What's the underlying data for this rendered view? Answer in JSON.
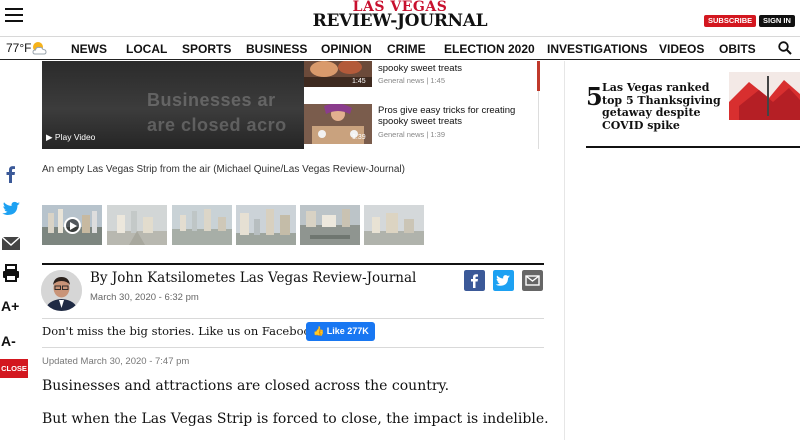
{
  "header": {
    "logo_line1": "LAS VEGAS",
    "logo_line2": "REVIEW-JOURNAL",
    "subscribe_label": "SUBSCRIBE",
    "signin_label": "SIGN IN",
    "menu_icon": "hamburger-menu-icon",
    "brand_color": "#c8102e"
  },
  "nav": {
    "weather": "77°F",
    "weather_icon": "partly-cloudy-icon",
    "items": [
      "NEWS",
      "LOCAL",
      "SPORTS",
      "BUSINESS",
      "OPINION",
      "CRIME",
      "ELECTION 2020",
      "INVESTIGATIONS",
      "VIDEOS",
      "OBITS"
    ],
    "search_icon": "search-icon"
  },
  "video": {
    "overlay_text_line1": "Businesses ar",
    "overlay_text_line2": "are closed acro",
    "play_label": "Play Video",
    "playlist": [
      {
        "title": "spooky sweet treats",
        "meta": "General news  |  1:45",
        "duration": "1:45"
      },
      {
        "title": "Pros give easy tricks for creating spooky sweet treats",
        "meta": "General news  |  1:39",
        "duration": "1:39"
      }
    ]
  },
  "caption": "An empty Las Vegas Strip from the air (Michael Quine/Las Vegas Review-Journal)",
  "gallery": {
    "thumb_count": 6
  },
  "share": {
    "icons": [
      "facebook-icon",
      "twitter-icon",
      "email-icon",
      "print-icon"
    ],
    "font_increase": "A+",
    "font_decrease": "A-",
    "close_label": "CLOSE"
  },
  "byline": {
    "by": "By",
    "author": "John Katsilometes",
    "outlet": "Las Vegas Review-Journal",
    "date": "March 30, 2020 - 6:32 pm"
  },
  "facebook_promo": {
    "text": "Don't miss the big stories. Like us on Facebook.",
    "like_label": "Like",
    "like_count": "277K",
    "color": "#1877f2"
  },
  "updated": "Updated March 30, 2020 - 7:47 pm",
  "article": {
    "paragraphs": [
      "Businesses and attractions are closed across the country.",
      "But when the Las Vegas Strip is forced to close, the impact is indelible."
    ]
  },
  "aside": {
    "rank": "5",
    "title": "Las Vegas ranked top 5 Thanksgiving getaway despite COVID spike"
  }
}
